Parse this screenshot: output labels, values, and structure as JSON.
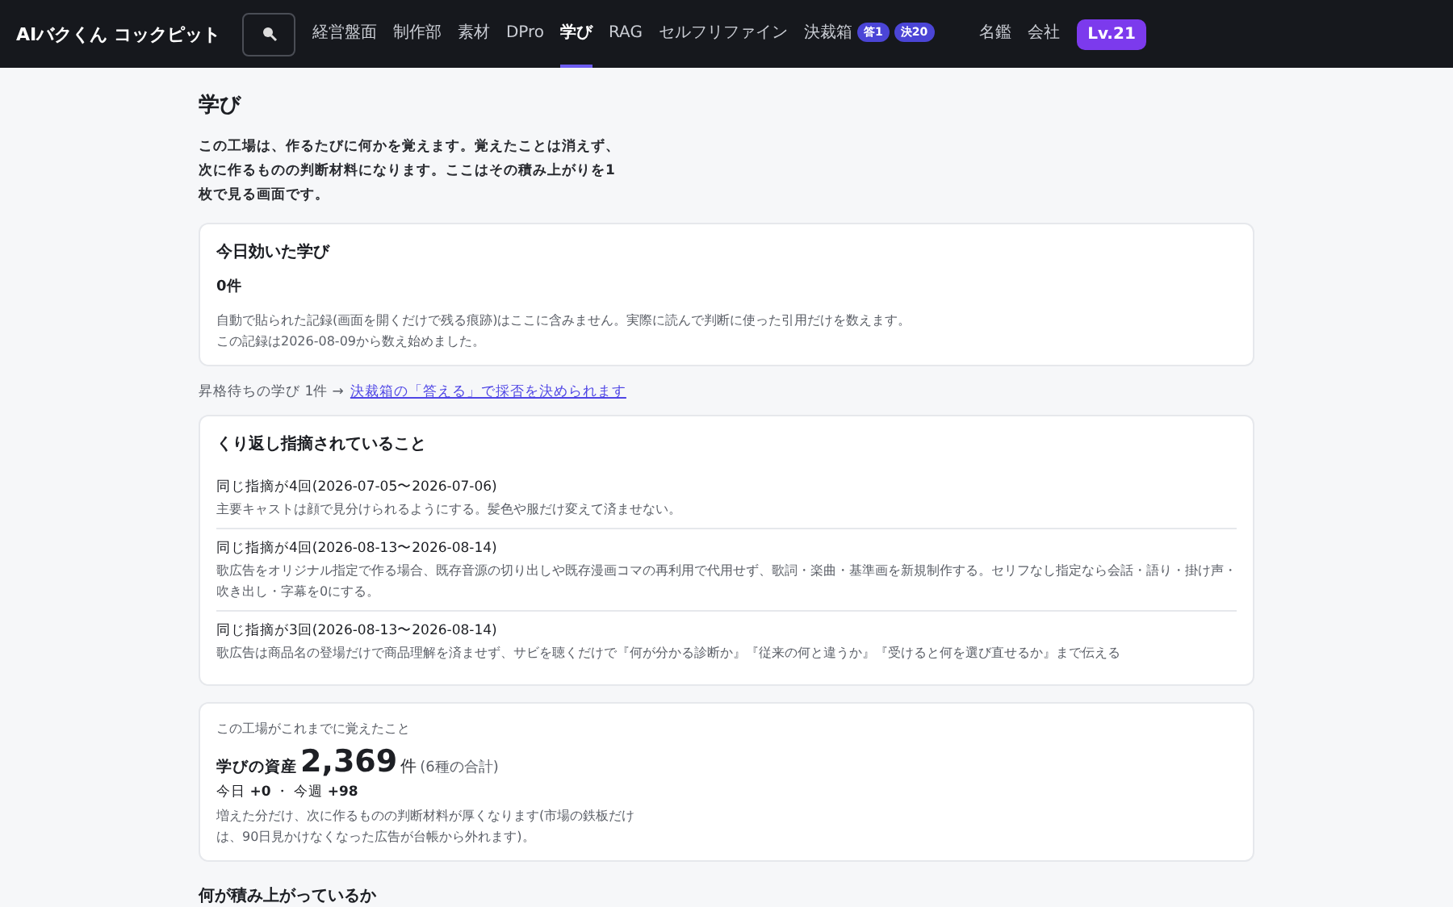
{
  "header": {
    "app_title": "AIバクくん コックピット",
    "nav": [
      {
        "label": "経営盤面",
        "selected": false
      },
      {
        "label": "制作部",
        "selected": false
      },
      {
        "label": "素材",
        "selected": false
      },
      {
        "label": "DPro",
        "selected": false
      },
      {
        "label": "学び",
        "selected": true
      },
      {
        "label": "RAG",
        "selected": false
      },
      {
        "label": "セルフリファイン",
        "selected": false
      },
      {
        "label": "決裁箱",
        "selected": false,
        "badges": [
          "答1",
          "決20"
        ]
      }
    ],
    "right_links": [
      "名鑑",
      "会社"
    ],
    "level_badge": "Lv.21"
  },
  "page": {
    "title": "学び",
    "intro": "この工場は、作るたびに何かを覚えます。覚えたことは消えず、次に作るものの判断材料になります。ここはその積み上がりを1枚で見る画面です。",
    "today_card": {
      "title": "今日効いた学び",
      "count": "0件",
      "notes": [
        "自動で貼られた記録(画面を開くだけで残る痕跡)はここに含みません。実際に読んで判断に使った引用だけを数えます。",
        "この記録は2026-08-09から数え始めました。"
      ]
    },
    "pending": {
      "text": "昇格待ちの学び 1件 →",
      "link": "決裁箱の「答える」で採否を決められます"
    },
    "repeated_card": {
      "title": "くり返し指摘されていること",
      "items": [
        {
          "heading": "同じ指摘が4回(2026-07-05〜2026-07-06)",
          "body": "主要キャストは顔で見分けられるようにする。髪色や服だけ変えて済ませない。"
        },
        {
          "heading": "同じ指摘が4回(2026-08-13〜2026-08-14)",
          "body": "歌広告をオリジナル指定で作る場合、既存音源の切り出しや既存漫画コマの再利用で代用せず、歌詞・楽曲・基準画を新規制作する。セリフなし指定なら会話・語り・掛け声・吹き出し・字幕を0にする。"
        },
        {
          "heading": "同じ指摘が3回(2026-08-13〜2026-08-14)",
          "body": "歌広告は商品名の登場だけで商品理解を済ませず、サビを聴くだけで『何が分かる診断か』『従来の何と違うか』『受けると何を選び直せるか』まで伝える"
        }
      ]
    },
    "asset_card": {
      "caption": "この工場がこれまでに覚えたこと",
      "label": "学びの資産",
      "value": "2,369",
      "unit": "件",
      "detail": "(6種の合計)",
      "delta": "今日 **+0** ・ 今週 **+98**",
      "note": "増えた分だけ、次に作るものの判断材料が厚くなります(市場の鉄板だけは、90日見かけなくなった広告が台帳から外れます)。"
    },
    "section_heading": "何が積み上がっているか"
  }
}
